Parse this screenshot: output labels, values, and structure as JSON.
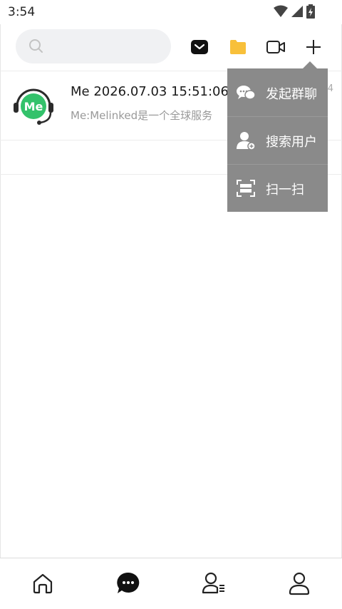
{
  "status_bar": {
    "time": "3:54"
  },
  "search": {
    "placeholder": ""
  },
  "toolbar": {
    "mail_icon": "mail-icon",
    "folder_icon": "folder-icon",
    "video_icon": "video-camera-icon",
    "add_icon": "plus-icon",
    "folder_color": "#f8c03a"
  },
  "chat_list": [
    {
      "avatar_text": "Me",
      "title": "Me 2026.07.03 15:51:06",
      "preview": "Me:Melinked是一个全球服务",
      "time": "4"
    }
  ],
  "popup_menu": {
    "items": [
      {
        "label": "发起群聊",
        "icon": "group-chat-icon"
      },
      {
        "label": "搜索用户",
        "icon": "add-user-icon"
      },
      {
        "label": "扫一扫",
        "icon": "scan-icon"
      }
    ]
  },
  "bottom_nav": [
    {
      "icon": "home-icon"
    },
    {
      "icon": "chat-icon"
    },
    {
      "icon": "contacts-icon"
    },
    {
      "icon": "profile-icon"
    }
  ],
  "colors": {
    "avatar_green": "#33c26b",
    "popup_bg": "#8a8a8a"
  }
}
